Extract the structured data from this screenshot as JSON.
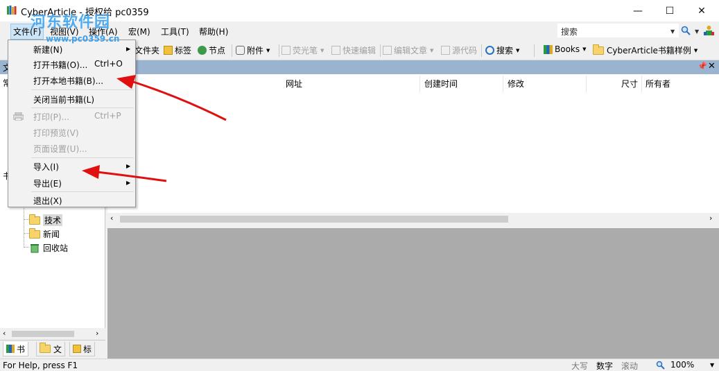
{
  "window": {
    "title": "CyberArticle - 授权给 pc0359",
    "minimize": "—",
    "maximize": "☐",
    "close": "✕"
  },
  "watermark": {
    "line1": "河东软件园",
    "line2": "www.pc0359.cn"
  },
  "menubar": {
    "items": [
      "文件(F)",
      "视图(V)",
      "操作(A)",
      "宏(M)",
      "工具(T)",
      "帮助(H)"
    ],
    "search_placeholder": "搜索"
  },
  "toolbar": {
    "folder": "文件夹",
    "bookmark": "标签",
    "node": "节点",
    "attachment": "附件",
    "highlighter": "荧光笔",
    "quick_edit": "快速编辑",
    "edit_article": "编辑文章",
    "source": "源代码",
    "search": "搜索",
    "books": "Books",
    "sample": "CyberArticle书籍样例"
  },
  "panel": {
    "left_title": "文",
    "left_label": "常"
  },
  "left_tree": {
    "partial_label": "书",
    "nodes": [
      "技术",
      "新闻",
      "回收站"
    ]
  },
  "bottom_tabs": [
    "书",
    "文",
    "标"
  ],
  "list_columns": [
    "网址",
    "创建时间",
    "修改",
    "尺寸",
    "所有者"
  ],
  "file_menu": {
    "items": [
      {
        "label": "新建(N)",
        "shortcut": "",
        "submenu": true,
        "disabled": false
      },
      {
        "label": "打开书籍(O)...",
        "shortcut": "Ctrl+O",
        "submenu": false,
        "disabled": false
      },
      {
        "label": "打开本地书籍(B)...",
        "shortcut": "",
        "submenu": false,
        "disabled": false
      },
      {
        "label": "关闭当前书籍(L)",
        "shortcut": "",
        "submenu": false,
        "disabled": false
      },
      {
        "label": "打印(P)...",
        "shortcut": "Ctrl+P",
        "submenu": false,
        "disabled": true
      },
      {
        "label": "打印预览(V)",
        "shortcut": "",
        "submenu": false,
        "disabled": true
      },
      {
        "label": "页面设置(U)...",
        "shortcut": "",
        "submenu": false,
        "disabled": true
      },
      {
        "label": "导入(I)",
        "shortcut": "",
        "submenu": true,
        "disabled": false
      },
      {
        "label": "导出(E)",
        "shortcut": "",
        "submenu": true,
        "disabled": false
      },
      {
        "label": "退出(X)",
        "shortcut": "",
        "submenu": false,
        "disabled": false
      }
    ]
  },
  "statusbar": {
    "help": "For Help, press F1",
    "caps": "大写",
    "num": "数字",
    "scroll": "滚动",
    "zoom": "100%"
  },
  "colors": {
    "panel_strip": "#9ab4d0",
    "arrow": "#e01010",
    "watermark": "#3da2ef"
  }
}
